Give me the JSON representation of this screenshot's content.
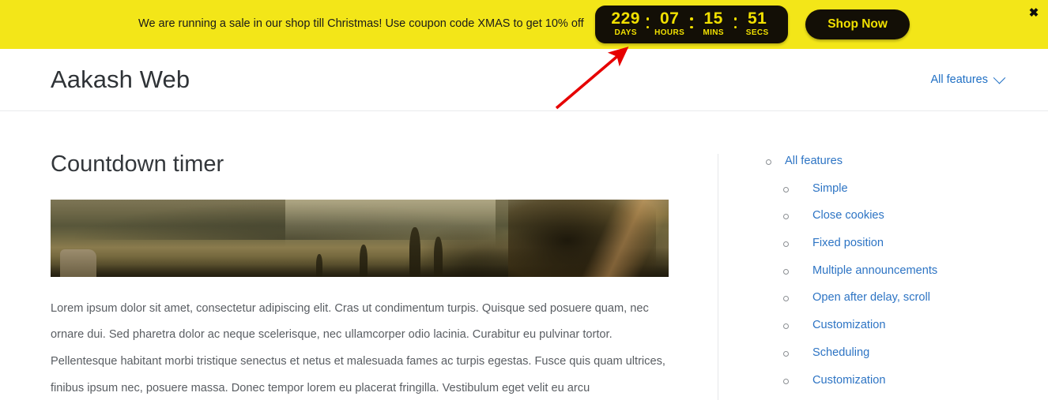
{
  "announcement": {
    "message": "We are running a sale in our shop till Christmas! Use coupon code XMAS to get 10% off",
    "cta_label": "Shop Now",
    "close_label": "✖",
    "background_color": "#f3e618",
    "widget_background_color": "#130f06",
    "widget_text_color": "#f1e000",
    "countdown": [
      {
        "value": "229",
        "label": "DAYS"
      },
      {
        "value": "07",
        "label": "HOURS"
      },
      {
        "value": "15",
        "label": "MINS"
      },
      {
        "value": "51",
        "label": "SECS"
      }
    ]
  },
  "header": {
    "brand": "Aakash Web",
    "nav_label": "All features",
    "nav_icon": "chevron-down-icon",
    "link_color": "#1f6fc4"
  },
  "main": {
    "title": "Countdown timer",
    "hero_image_alt": "tuscan-landscape-photo",
    "paragraphs": [
      "Lorem ipsum dolor sit amet, consectetur adipiscing elit. Cras ut condimentum turpis. Quisque sed posuere quam, nec ornare dui. Sed pharetra dolor ac neque scelerisque, nec ullamcorper odio lacinia. Curabitur eu pulvinar tortor.",
      "Pellentesque habitant morbi tristique senectus et netus et malesuada fames ac turpis egestas. Fusce quis quam ultrices, finibus ipsum nec, posuere massa. Donec tempor lorem eu placerat fringilla. Vestibulum eget velit eu arcu"
    ]
  },
  "sidebar": {
    "top_item": "All features",
    "items": [
      "Simple",
      "Close cookies",
      "Fixed position",
      "Multiple announcements",
      "Open after delay, scroll",
      "Customization",
      "Scheduling",
      "Customization"
    ],
    "link_color": "#2d74c4"
  },
  "annotation": {
    "type": "arrow",
    "color": "#e60000",
    "points_to": "countdown-timer-widget"
  }
}
